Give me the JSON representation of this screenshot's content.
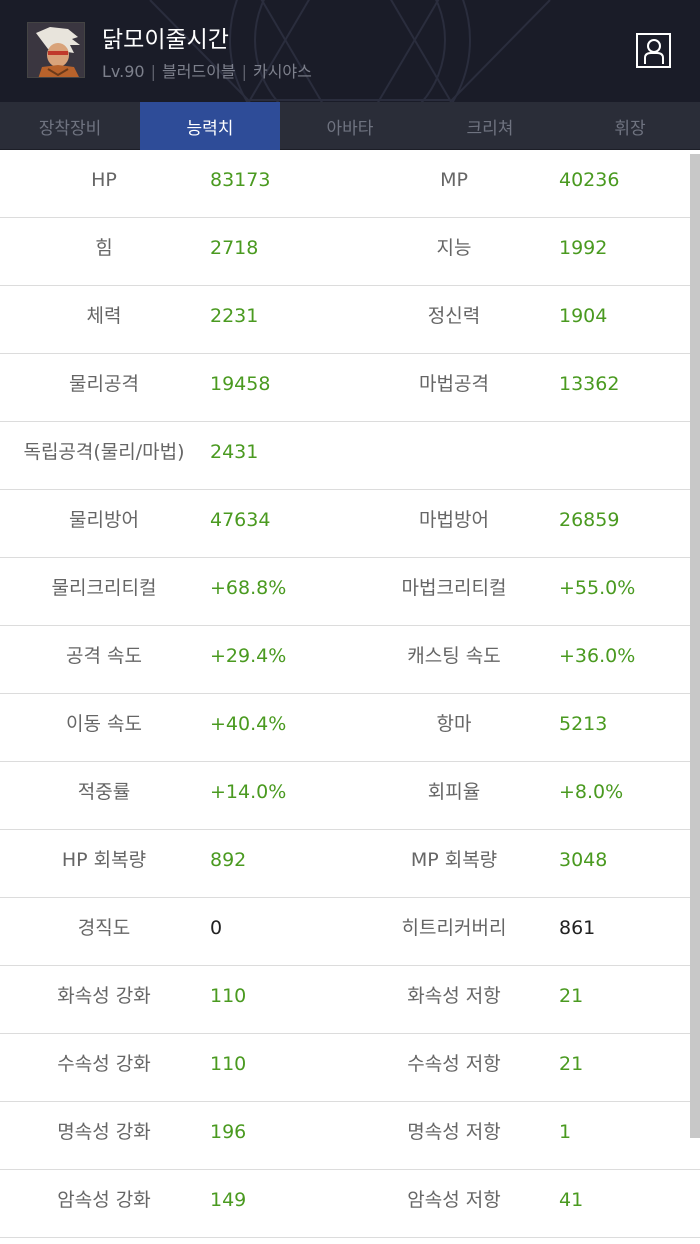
{
  "header": {
    "name": "닭모이줄시간",
    "level": "Lv.90",
    "job": "블러드이블",
    "server": "카시야스",
    "separator": "|"
  },
  "tabs": [
    {
      "label": "장착장비",
      "active": false
    },
    {
      "label": "능력치",
      "active": true
    },
    {
      "label": "아바타",
      "active": false
    },
    {
      "label": "크리쳐",
      "active": false
    },
    {
      "label": "휘장",
      "active": false
    }
  ],
  "stats": [
    {
      "left_label": "HP",
      "left_value": "83173",
      "right_label": "MP",
      "right_value": "40236"
    },
    {
      "left_label": "힘",
      "left_value": "2718",
      "right_label": "지능",
      "right_value": "1992"
    },
    {
      "left_label": "체력",
      "left_value": "2231",
      "right_label": "정신력",
      "right_value": "1904"
    },
    {
      "left_label": "물리공격",
      "left_value": "19458",
      "right_label": "마법공격",
      "right_value": "13362"
    },
    {
      "left_label": "독립공격(물리/마법)",
      "left_value": "2431",
      "right_label": "",
      "right_value": ""
    },
    {
      "left_label": "물리방어",
      "left_value": "47634",
      "right_label": "마법방어",
      "right_value": "26859"
    },
    {
      "left_label": "물리크리티컬",
      "left_value": "+68.8%",
      "right_label": "마법크리티컬",
      "right_value": "+55.0%"
    },
    {
      "left_label": "공격 속도",
      "left_value": "+29.4%",
      "right_label": "캐스팅 속도",
      "right_value": "+36.0%"
    },
    {
      "left_label": "이동 속도",
      "left_value": "+40.4%",
      "right_label": "항마",
      "right_value": "5213"
    },
    {
      "left_label": "적중률",
      "left_value": "+14.0%",
      "right_label": "회피율",
      "right_value": "+8.0%"
    },
    {
      "left_label": "HP 회복량",
      "left_value": "892",
      "right_label": "MP 회복량",
      "right_value": "3048"
    },
    {
      "left_label": "경직도",
      "left_value": "0",
      "right_label": "히트리커버리",
      "right_value": "861"
    },
    {
      "left_label": "화속성 강화",
      "left_value": "110",
      "right_label": "화속성 저항",
      "right_value": "21"
    },
    {
      "left_label": "수속성 강화",
      "left_value": "110",
      "right_label": "수속성 저항",
      "right_value": "21"
    },
    {
      "left_label": "명속성 강화",
      "left_value": "196",
      "right_label": "명속성 저항",
      "right_value": "1"
    },
    {
      "left_label": "암속성 강화",
      "left_value": "149",
      "right_label": "암속성 저항",
      "right_value": "41"
    }
  ],
  "colors": {
    "header_bg": "#1a1c28",
    "tab_bg": "#2a2d38",
    "tab_active": "#2e4c98",
    "value_green": "#4a9a20",
    "value_black": "#222222",
    "label_gray": "#666666"
  },
  "icons": {
    "profile": "person-silhouette-icon",
    "avatar": "character-portrait"
  }
}
